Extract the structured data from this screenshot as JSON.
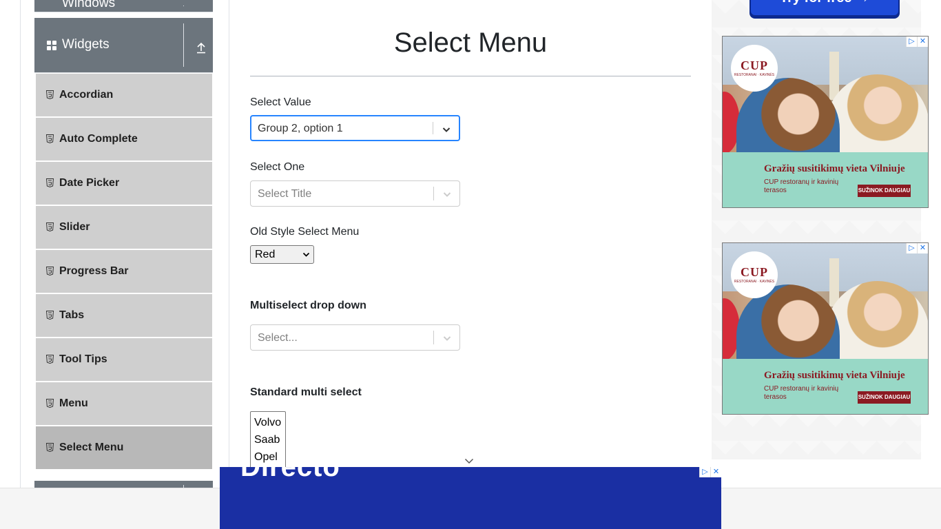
{
  "sidebar": {
    "prev_group_title": "Windows",
    "group_title": "Widgets",
    "items": [
      {
        "label": "Accordian"
      },
      {
        "label": "Auto Complete"
      },
      {
        "label": "Date Picker"
      },
      {
        "label": "Slider"
      },
      {
        "label": "Progress Bar"
      },
      {
        "label": "Tabs"
      },
      {
        "label": "Tool Tips"
      },
      {
        "label": "Menu"
      },
      {
        "label": "Select Menu",
        "active": true
      }
    ]
  },
  "main": {
    "title": "Select Menu",
    "select_value": {
      "label": "Select Value",
      "value": "Group 2, option 1"
    },
    "select_one": {
      "label": "Select One",
      "placeholder": "Select Title"
    },
    "old_style": {
      "label": "Old Style Select Menu",
      "value": "Red"
    },
    "multiselect": {
      "label": "Multiselect drop down",
      "placeholder": "Select..."
    },
    "standard_multi": {
      "label": "Standard multi select",
      "options": [
        "Volvo",
        "Saab",
        "Opel"
      ]
    }
  },
  "ads": {
    "try_button": "Try for free →",
    "ad1": {
      "logo": "CUP",
      "logo_sub": "RESTORANAI · KAVINĖS",
      "headline": "Gražių susitikimų vieta Vilniuje",
      "sub": "CUP restoranų ir kavinių terasos",
      "cta": "SUŽINOK DAUGIAU"
    },
    "ad2": {
      "logo": "CUP",
      "logo_sub": "RESTORANAI · KAVINĖS",
      "headline": "Gražių susitikimų vieta Vilniuje",
      "sub": "CUP restoranų ir kavinių terasos",
      "cta": "SUŽINOK DAUGIAU"
    },
    "bottom_brand": "Directo",
    "adchoices": "▷",
    "close": "✕"
  },
  "colors": {
    "sidebar_header": "#6c757d",
    "sidebar_item": "#cfcfcf",
    "sidebar_item_active": "#b8b8b8",
    "focus_border": "#2684ff",
    "bottom_ad": "#1a2fa3"
  }
}
